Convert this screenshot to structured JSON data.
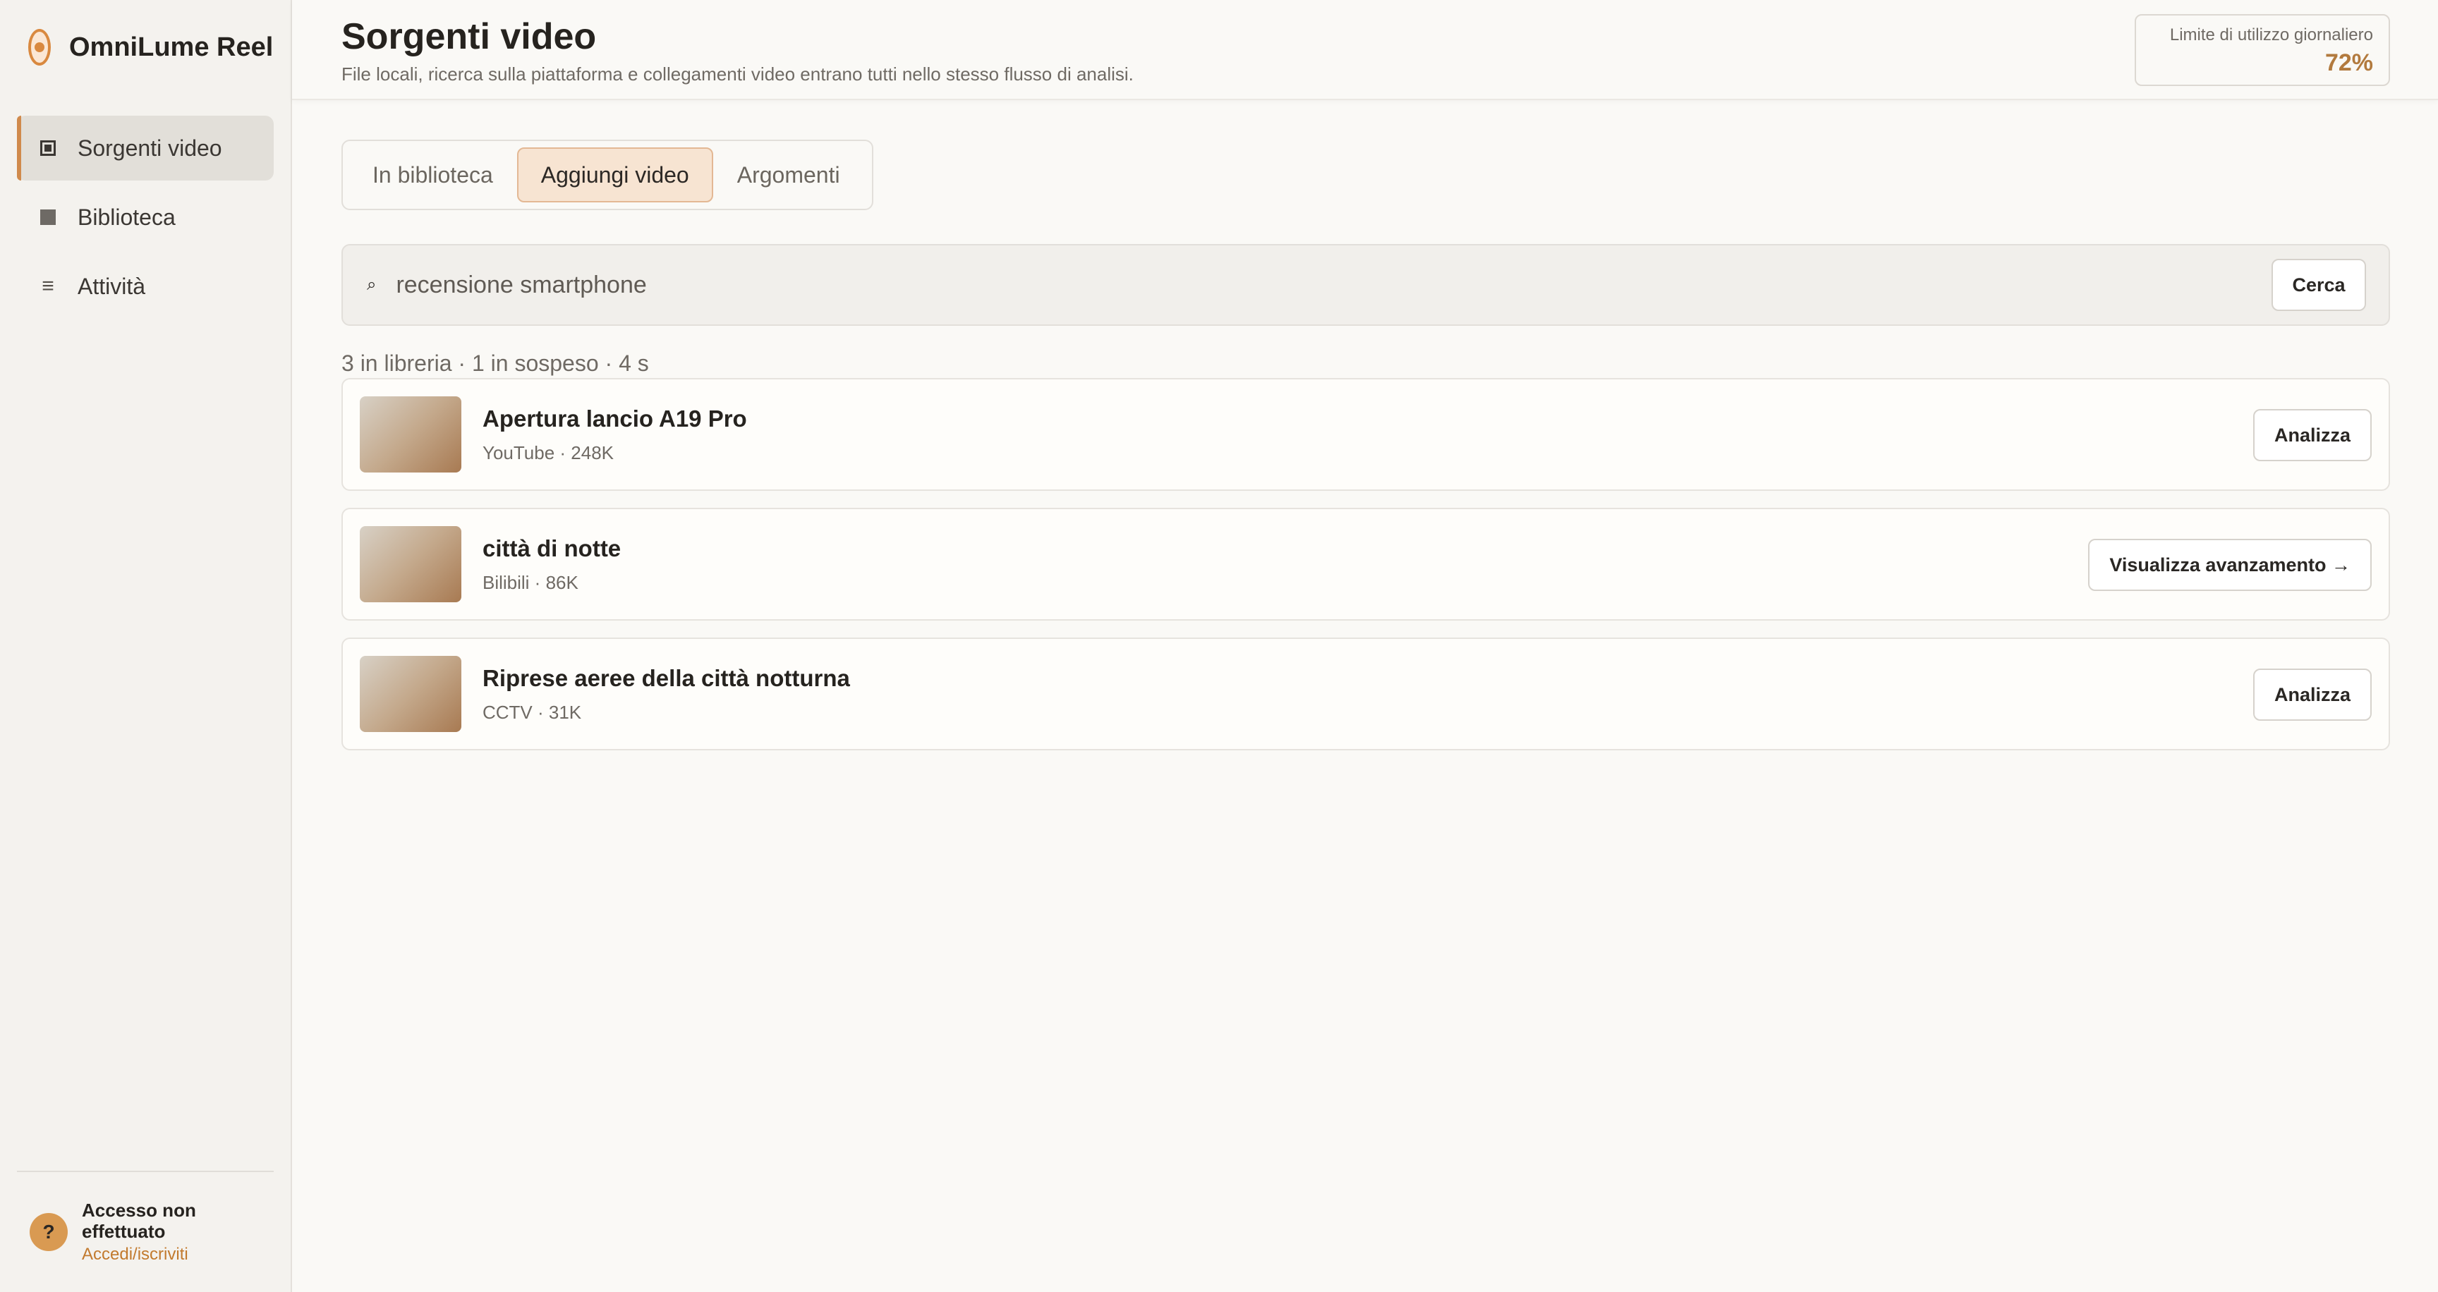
{
  "app": {
    "name": "OmniLume Reel"
  },
  "sidebar": {
    "items": [
      {
        "label": "Sorgenti video",
        "icon": "video-source-icon",
        "active": true
      },
      {
        "label": "Biblioteca",
        "icon": "library-icon",
        "active": false
      },
      {
        "label": "Attività",
        "icon": "list-icon",
        "active": false
      }
    ],
    "user": {
      "avatar": "?",
      "status": "Accesso non effettuato",
      "link": "Accedi/iscriviti"
    }
  },
  "header": {
    "title": "Sorgenti video",
    "subtitle": "File locali, ricerca sulla piattaforma e collegamenti video entrano tutti nello stesso flusso di analisi.",
    "usage_label": "Limite di utilizzo giornaliero",
    "usage_value": "72%"
  },
  "tabs": [
    {
      "label": "In biblioteca",
      "active": false
    },
    {
      "label": "Aggiungi video",
      "active": true
    },
    {
      "label": "Argomenti",
      "active": false
    }
  ],
  "search": {
    "icon": "⌕",
    "value": "recensione smartphone",
    "button": "Cerca"
  },
  "results": {
    "summary": "3 in libreria · 1 in sospeso · 4 s",
    "items": [
      {
        "title": "Apertura lancio A19 Pro",
        "meta": "YouTube · 248K",
        "action": "Analizza"
      },
      {
        "title": "città di notte",
        "meta": "Bilibili · 86K",
        "action": "Visualizza avanzamento →"
      },
      {
        "title": "Riprese aeree della città notturna",
        "meta": "CCTV · 31K",
        "action": "Analizza"
      }
    ]
  },
  "colors": {
    "accent": "#d08a4c",
    "usage_value": "#b27a3e",
    "link": "#c27a2e"
  }
}
